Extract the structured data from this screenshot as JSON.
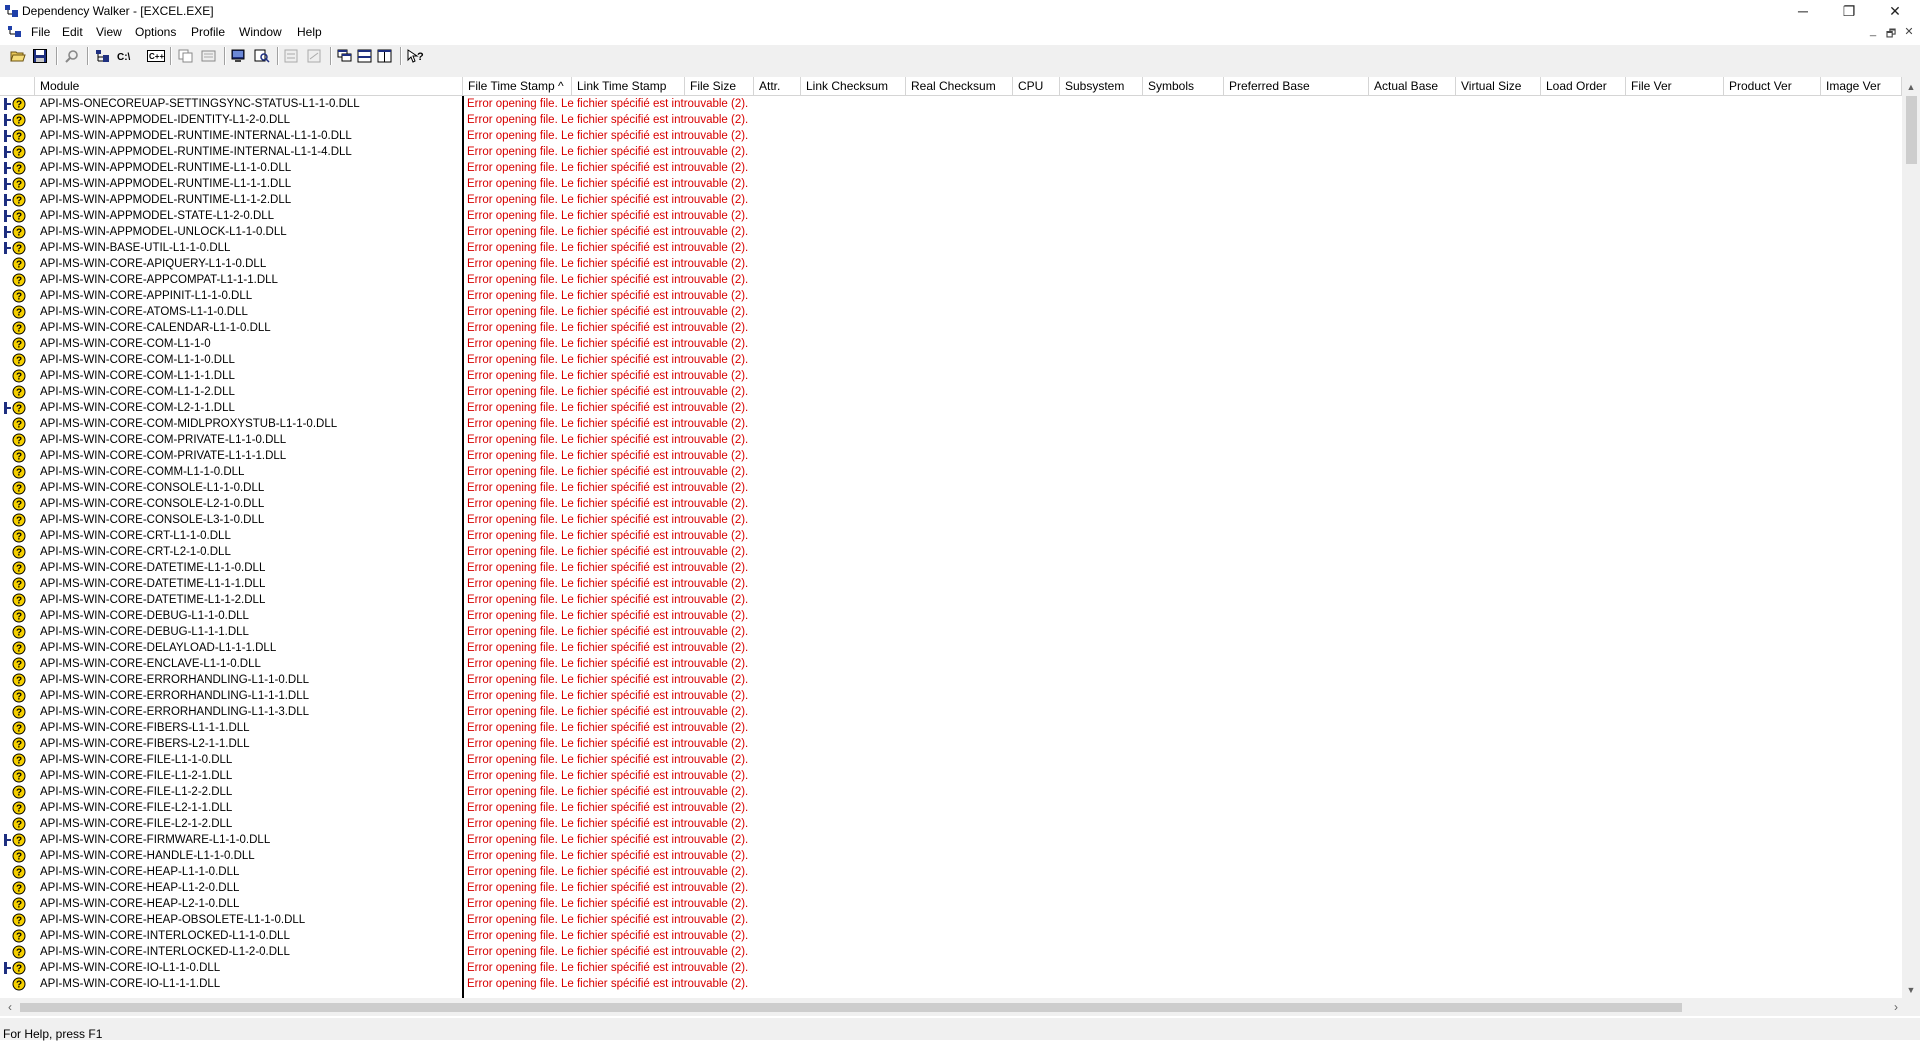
{
  "window": {
    "title": "Dependency Walker - [EXCEL.EXE]",
    "controls": {
      "minimize": "─",
      "maximize": "❐",
      "close": "✕"
    }
  },
  "menu": {
    "items": [
      "File",
      "Edit",
      "View",
      "Options",
      "Profile",
      "Window",
      "Help"
    ],
    "child_controls": {
      "minimize": "_",
      "restore": "🗗",
      "close": "✕"
    }
  },
  "toolbar": {
    "buttons": [
      "open-icon",
      "save-icon",
      "find-icon",
      "full-paths-icon",
      "c-undecorate-icon",
      "highlight-module-icon",
      "copy-icon",
      "properties-icon",
      "view-module-icon",
      "external-viewer-icon",
      "expand-all-icon",
      "collapse-all-icon",
      "cascade-icon",
      "tile-horizontal-icon",
      "tile-vertical-icon",
      "context-help-icon"
    ]
  },
  "columns": [
    "Module",
    "File Time Stamp ^",
    "Link Time Stamp",
    "File Size",
    "Attr.",
    "Link Checksum",
    "Real Checksum",
    "CPU",
    "Subsystem",
    "Symbols",
    "Preferred Base",
    "Actual Base",
    "Virtual Size",
    "Load Order",
    "File Ver",
    "Product Ver",
    "Image Ver"
  ],
  "error_text": "Error opening file. Le fichier spécifié est introuvable (2).",
  "rows": [
    {
      "module": "API-MS-ONECOREUAP-SETTINGSYNC-STATUS-L1-1-0.DLL",
      "flag": true
    },
    {
      "module": "API-MS-WIN-APPMODEL-IDENTITY-L1-2-0.DLL",
      "flag": true
    },
    {
      "module": "API-MS-WIN-APPMODEL-RUNTIME-INTERNAL-L1-1-0.DLL",
      "flag": true
    },
    {
      "module": "API-MS-WIN-APPMODEL-RUNTIME-INTERNAL-L1-1-4.DLL",
      "flag": true
    },
    {
      "module": "API-MS-WIN-APPMODEL-RUNTIME-L1-1-0.DLL",
      "flag": true
    },
    {
      "module": "API-MS-WIN-APPMODEL-RUNTIME-L1-1-1.DLL",
      "flag": true
    },
    {
      "module": "API-MS-WIN-APPMODEL-RUNTIME-L1-1-2.DLL",
      "flag": true
    },
    {
      "module": "API-MS-WIN-APPMODEL-STATE-L1-2-0.DLL",
      "flag": true
    },
    {
      "module": "API-MS-WIN-APPMODEL-UNLOCK-L1-1-0.DLL",
      "flag": true
    },
    {
      "module": "API-MS-WIN-BASE-UTIL-L1-1-0.DLL",
      "flag": true
    },
    {
      "module": "API-MS-WIN-CORE-APIQUERY-L1-1-0.DLL",
      "flag": false
    },
    {
      "module": "API-MS-WIN-CORE-APPCOMPAT-L1-1-1.DLL",
      "flag": false
    },
    {
      "module": "API-MS-WIN-CORE-APPINIT-L1-1-0.DLL",
      "flag": false
    },
    {
      "module": "API-MS-WIN-CORE-ATOMS-L1-1-0.DLL",
      "flag": false
    },
    {
      "module": "API-MS-WIN-CORE-CALENDAR-L1-1-0.DLL",
      "flag": false
    },
    {
      "module": "API-MS-WIN-CORE-COM-L1-1-0",
      "flag": false
    },
    {
      "module": "API-MS-WIN-CORE-COM-L1-1-0.DLL",
      "flag": false
    },
    {
      "module": "API-MS-WIN-CORE-COM-L1-1-1.DLL",
      "flag": false
    },
    {
      "module": "API-MS-WIN-CORE-COM-L1-1-2.DLL",
      "flag": false
    },
    {
      "module": "API-MS-WIN-CORE-COM-L2-1-1.DLL",
      "flag": true
    },
    {
      "module": "API-MS-WIN-CORE-COM-MIDLPROXYSTUB-L1-1-0.DLL",
      "flag": false
    },
    {
      "module": "API-MS-WIN-CORE-COM-PRIVATE-L1-1-0.DLL",
      "flag": false
    },
    {
      "module": "API-MS-WIN-CORE-COM-PRIVATE-L1-1-1.DLL",
      "flag": false
    },
    {
      "module": "API-MS-WIN-CORE-COMM-L1-1-0.DLL",
      "flag": false
    },
    {
      "module": "API-MS-WIN-CORE-CONSOLE-L1-1-0.DLL",
      "flag": false
    },
    {
      "module": "API-MS-WIN-CORE-CONSOLE-L2-1-0.DLL",
      "flag": false
    },
    {
      "module": "API-MS-WIN-CORE-CONSOLE-L3-1-0.DLL",
      "flag": false
    },
    {
      "module": "API-MS-WIN-CORE-CRT-L1-1-0.DLL",
      "flag": false
    },
    {
      "module": "API-MS-WIN-CORE-CRT-L2-1-0.DLL",
      "flag": false
    },
    {
      "module": "API-MS-WIN-CORE-DATETIME-L1-1-0.DLL",
      "flag": false
    },
    {
      "module": "API-MS-WIN-CORE-DATETIME-L1-1-1.DLL",
      "flag": false
    },
    {
      "module": "API-MS-WIN-CORE-DATETIME-L1-1-2.DLL",
      "flag": false
    },
    {
      "module": "API-MS-WIN-CORE-DEBUG-L1-1-0.DLL",
      "flag": false
    },
    {
      "module": "API-MS-WIN-CORE-DEBUG-L1-1-1.DLL",
      "flag": false
    },
    {
      "module": "API-MS-WIN-CORE-DELAYLOAD-L1-1-1.DLL",
      "flag": false
    },
    {
      "module": "API-MS-WIN-CORE-ENCLAVE-L1-1-0.DLL",
      "flag": false
    },
    {
      "module": "API-MS-WIN-CORE-ERRORHANDLING-L1-1-0.DLL",
      "flag": false
    },
    {
      "module": "API-MS-WIN-CORE-ERRORHANDLING-L1-1-1.DLL",
      "flag": false
    },
    {
      "module": "API-MS-WIN-CORE-ERRORHANDLING-L1-1-3.DLL",
      "flag": false
    },
    {
      "module": "API-MS-WIN-CORE-FIBERS-L1-1-1.DLL",
      "flag": false
    },
    {
      "module": "API-MS-WIN-CORE-FIBERS-L2-1-1.DLL",
      "flag": false
    },
    {
      "module": "API-MS-WIN-CORE-FILE-L1-1-0.DLL",
      "flag": false
    },
    {
      "module": "API-MS-WIN-CORE-FILE-L1-2-1.DLL",
      "flag": false
    },
    {
      "module": "API-MS-WIN-CORE-FILE-L1-2-2.DLL",
      "flag": false
    },
    {
      "module": "API-MS-WIN-CORE-FILE-L2-1-1.DLL",
      "flag": false
    },
    {
      "module": "API-MS-WIN-CORE-FILE-L2-1-2.DLL",
      "flag": false
    },
    {
      "module": "API-MS-WIN-CORE-FIRMWARE-L1-1-0.DLL",
      "flag": true
    },
    {
      "module": "API-MS-WIN-CORE-HANDLE-L1-1-0.DLL",
      "flag": false
    },
    {
      "module": "API-MS-WIN-CORE-HEAP-L1-1-0.DLL",
      "flag": false
    },
    {
      "module": "API-MS-WIN-CORE-HEAP-L1-2-0.DLL",
      "flag": false
    },
    {
      "module": "API-MS-WIN-CORE-HEAP-L2-1-0.DLL",
      "flag": false
    },
    {
      "module": "API-MS-WIN-CORE-HEAP-OBSOLETE-L1-1-0.DLL",
      "flag": false
    },
    {
      "module": "API-MS-WIN-CORE-INTERLOCKED-L1-1-0.DLL",
      "flag": false
    },
    {
      "module": "API-MS-WIN-CORE-INTERLOCKED-L1-2-0.DLL",
      "flag": false
    },
    {
      "module": "API-MS-WIN-CORE-IO-L1-1-0.DLL",
      "flag": true
    },
    {
      "module": "API-MS-WIN-CORE-IO-L1-1-1.DLL",
      "flag": false
    }
  ],
  "status": {
    "text": "For Help, press F1"
  },
  "colors": {
    "error": "#d80000",
    "warning_icon": "#f5d000"
  }
}
